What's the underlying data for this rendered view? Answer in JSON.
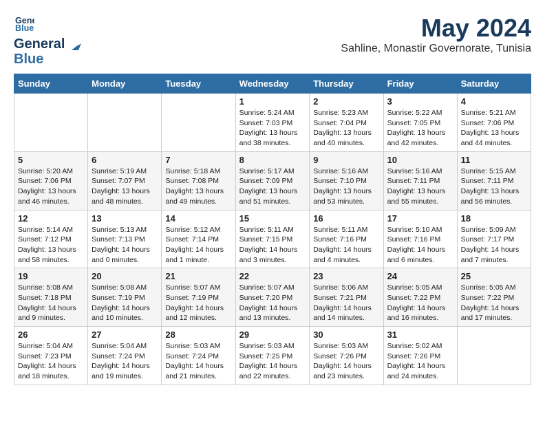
{
  "logo": {
    "line1": "General",
    "line2": "Blue"
  },
  "title": "May 2024",
  "location": "Sahline, Monastir Governorate, Tunisia",
  "weekdays": [
    "Sunday",
    "Monday",
    "Tuesday",
    "Wednesday",
    "Thursday",
    "Friday",
    "Saturday"
  ],
  "weeks": [
    [
      {
        "day": "",
        "sunrise": "",
        "sunset": "",
        "daylight": ""
      },
      {
        "day": "",
        "sunrise": "",
        "sunset": "",
        "daylight": ""
      },
      {
        "day": "",
        "sunrise": "",
        "sunset": "",
        "daylight": ""
      },
      {
        "day": "1",
        "sunrise": "Sunrise: 5:24 AM",
        "sunset": "Sunset: 7:03 PM",
        "daylight": "Daylight: 13 hours and 38 minutes."
      },
      {
        "day": "2",
        "sunrise": "Sunrise: 5:23 AM",
        "sunset": "Sunset: 7:04 PM",
        "daylight": "Daylight: 13 hours and 40 minutes."
      },
      {
        "day": "3",
        "sunrise": "Sunrise: 5:22 AM",
        "sunset": "Sunset: 7:05 PM",
        "daylight": "Daylight: 13 hours and 42 minutes."
      },
      {
        "day": "4",
        "sunrise": "Sunrise: 5:21 AM",
        "sunset": "Sunset: 7:06 PM",
        "daylight": "Daylight: 13 hours and 44 minutes."
      }
    ],
    [
      {
        "day": "5",
        "sunrise": "Sunrise: 5:20 AM",
        "sunset": "Sunset: 7:06 PM",
        "daylight": "Daylight: 13 hours and 46 minutes."
      },
      {
        "day": "6",
        "sunrise": "Sunrise: 5:19 AM",
        "sunset": "Sunset: 7:07 PM",
        "daylight": "Daylight: 13 hours and 48 minutes."
      },
      {
        "day": "7",
        "sunrise": "Sunrise: 5:18 AM",
        "sunset": "Sunset: 7:08 PM",
        "daylight": "Daylight: 13 hours and 49 minutes."
      },
      {
        "day": "8",
        "sunrise": "Sunrise: 5:17 AM",
        "sunset": "Sunset: 7:09 PM",
        "daylight": "Daylight: 13 hours and 51 minutes."
      },
      {
        "day": "9",
        "sunrise": "Sunrise: 5:16 AM",
        "sunset": "Sunset: 7:10 PM",
        "daylight": "Daylight: 13 hours and 53 minutes."
      },
      {
        "day": "10",
        "sunrise": "Sunrise: 5:16 AM",
        "sunset": "Sunset: 7:11 PM",
        "daylight": "Daylight: 13 hours and 55 minutes."
      },
      {
        "day": "11",
        "sunrise": "Sunrise: 5:15 AM",
        "sunset": "Sunset: 7:11 PM",
        "daylight": "Daylight: 13 hours and 56 minutes."
      }
    ],
    [
      {
        "day": "12",
        "sunrise": "Sunrise: 5:14 AM",
        "sunset": "Sunset: 7:12 PM",
        "daylight": "Daylight: 13 hours and 58 minutes."
      },
      {
        "day": "13",
        "sunrise": "Sunrise: 5:13 AM",
        "sunset": "Sunset: 7:13 PM",
        "daylight": "Daylight: 14 hours and 0 minutes."
      },
      {
        "day": "14",
        "sunrise": "Sunrise: 5:12 AM",
        "sunset": "Sunset: 7:14 PM",
        "daylight": "Daylight: 14 hours and 1 minute."
      },
      {
        "day": "15",
        "sunrise": "Sunrise: 5:11 AM",
        "sunset": "Sunset: 7:15 PM",
        "daylight": "Daylight: 14 hours and 3 minutes."
      },
      {
        "day": "16",
        "sunrise": "Sunrise: 5:11 AM",
        "sunset": "Sunset: 7:16 PM",
        "daylight": "Daylight: 14 hours and 4 minutes."
      },
      {
        "day": "17",
        "sunrise": "Sunrise: 5:10 AM",
        "sunset": "Sunset: 7:16 PM",
        "daylight": "Daylight: 14 hours and 6 minutes."
      },
      {
        "day": "18",
        "sunrise": "Sunrise: 5:09 AM",
        "sunset": "Sunset: 7:17 PM",
        "daylight": "Daylight: 14 hours and 7 minutes."
      }
    ],
    [
      {
        "day": "19",
        "sunrise": "Sunrise: 5:08 AM",
        "sunset": "Sunset: 7:18 PM",
        "daylight": "Daylight: 14 hours and 9 minutes."
      },
      {
        "day": "20",
        "sunrise": "Sunrise: 5:08 AM",
        "sunset": "Sunset: 7:19 PM",
        "daylight": "Daylight: 14 hours and 10 minutes."
      },
      {
        "day": "21",
        "sunrise": "Sunrise: 5:07 AM",
        "sunset": "Sunset: 7:19 PM",
        "daylight": "Daylight: 14 hours and 12 minutes."
      },
      {
        "day": "22",
        "sunrise": "Sunrise: 5:07 AM",
        "sunset": "Sunset: 7:20 PM",
        "daylight": "Daylight: 14 hours and 13 minutes."
      },
      {
        "day": "23",
        "sunrise": "Sunrise: 5:06 AM",
        "sunset": "Sunset: 7:21 PM",
        "daylight": "Daylight: 14 hours and 14 minutes."
      },
      {
        "day": "24",
        "sunrise": "Sunrise: 5:05 AM",
        "sunset": "Sunset: 7:22 PM",
        "daylight": "Daylight: 14 hours and 16 minutes."
      },
      {
        "day": "25",
        "sunrise": "Sunrise: 5:05 AM",
        "sunset": "Sunset: 7:22 PM",
        "daylight": "Daylight: 14 hours and 17 minutes."
      }
    ],
    [
      {
        "day": "26",
        "sunrise": "Sunrise: 5:04 AM",
        "sunset": "Sunset: 7:23 PM",
        "daylight": "Daylight: 14 hours and 18 minutes."
      },
      {
        "day": "27",
        "sunrise": "Sunrise: 5:04 AM",
        "sunset": "Sunset: 7:24 PM",
        "daylight": "Daylight: 14 hours and 19 minutes."
      },
      {
        "day": "28",
        "sunrise": "Sunrise: 5:03 AM",
        "sunset": "Sunset: 7:24 PM",
        "daylight": "Daylight: 14 hours and 21 minutes."
      },
      {
        "day": "29",
        "sunrise": "Sunrise: 5:03 AM",
        "sunset": "Sunset: 7:25 PM",
        "daylight": "Daylight: 14 hours and 22 minutes."
      },
      {
        "day": "30",
        "sunrise": "Sunrise: 5:03 AM",
        "sunset": "Sunset: 7:26 PM",
        "daylight": "Daylight: 14 hours and 23 minutes."
      },
      {
        "day": "31",
        "sunrise": "Sunrise: 5:02 AM",
        "sunset": "Sunset: 7:26 PM",
        "daylight": "Daylight: 14 hours and 24 minutes."
      },
      {
        "day": "",
        "sunrise": "",
        "sunset": "",
        "daylight": ""
      }
    ]
  ]
}
